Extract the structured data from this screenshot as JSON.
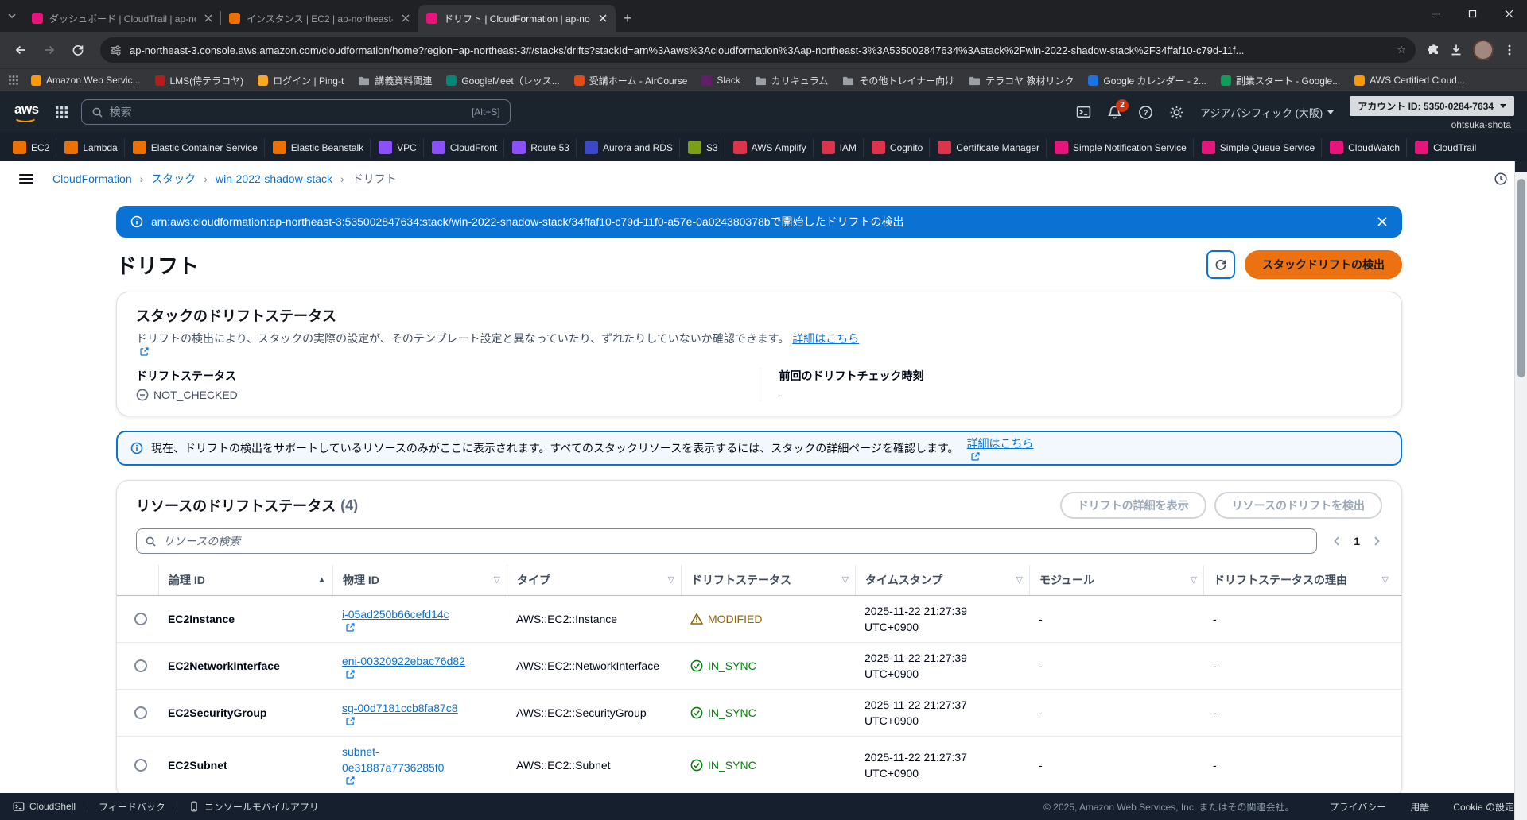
{
  "colors": {
    "accent_blue": "#0972d3",
    "primary_orange": "#ec7211",
    "status_warning": "#8d6605",
    "status_success": "#037f0c",
    "status_neutral": "#5f6b7a",
    "header_dark": "#1b232d",
    "banner_blue": "#0972d3"
  },
  "browser": {
    "tabs": [
      {
        "title": "ダッシュボード | CloudTrail | ap-no",
        "favicon_color": "#e7157b"
      },
      {
        "title": "インスタンス | EC2 | ap-northeast-",
        "favicon_color": "#ed7100"
      },
      {
        "title": "ドリフト | CloudFormation | ap-no",
        "favicon_color": "#e7157b"
      }
    ],
    "url": "ap-northeast-3.console.aws.amazon.com/cloudformation/home?region=ap-northeast-3#/stacks/drifts?stackId=arn%3Aaws%3Acloudformation%3Aap-northeast-3%3A535002847634%3Astack%2Fwin-2022-shadow-stack%2F34ffaf10-c79d-11f...",
    "bookmarks": [
      {
        "label": "Amazon Web Servic...",
        "icon": "aws-favicon",
        "color": "#ff9900"
      },
      {
        "label": "LMS(侍テラコヤ)",
        "icon": "lms-favicon",
        "color": "#b71c1c"
      },
      {
        "label": "ログイン | Ping-t",
        "icon": "pingt-favicon",
        "color": "#f9a825"
      },
      {
        "label": "講義資料関連",
        "icon": "folder-icon",
        "color": "#9aa0a6"
      },
      {
        "label": "GoogleMeet（レッス...",
        "icon": "meet-favicon",
        "color": "#00897b"
      },
      {
        "label": "受講ホーム - AirCourse",
        "icon": "aircourse-favicon",
        "color": "#e64a19"
      },
      {
        "label": "Slack",
        "icon": "slack-favicon",
        "color": "#611f69"
      },
      {
        "label": "カリキュラム",
        "icon": "folder-icon",
        "color": "#9aa0a6"
      },
      {
        "label": "その他トレイナー向け",
        "icon": "folder-icon",
        "color": "#9aa0a6"
      },
      {
        "label": "テラコヤ 教材リンク",
        "icon": "folder-icon",
        "color": "#9aa0a6"
      },
      {
        "label": "Google カレンダー - 2...",
        "icon": "calendar-favicon",
        "color": "#1a73e8"
      },
      {
        "label": "副業スタート - Google...",
        "icon": "sheets-favicon",
        "color": "#0f9d58"
      },
      {
        "label": "AWS Certified Cloud...",
        "icon": "aws-favicon",
        "color": "#ff9900"
      }
    ]
  },
  "aws_header": {
    "search_placeholder": "検索",
    "search_shortcut": "[Alt+S]",
    "notification_count": "2",
    "region": "アジアパシフィック (大阪)",
    "account_id": "アカウント ID: 5350-0284-7634",
    "account_name": "ohtsuka-shota"
  },
  "services": [
    {
      "label": "EC2",
      "color": "#ed7100"
    },
    {
      "label": "Lambda",
      "color": "#ed7100"
    },
    {
      "label": "Elastic Container Service",
      "color": "#ed7100"
    },
    {
      "label": "Elastic Beanstalk",
      "color": "#ed7100"
    },
    {
      "label": "VPC",
      "color": "#8c4fff"
    },
    {
      "label": "CloudFront",
      "color": "#8c4fff"
    },
    {
      "label": "Route 53",
      "color": "#8c4fff"
    },
    {
      "label": "Aurora and RDS",
      "color": "#3b48cc"
    },
    {
      "label": "S3",
      "color": "#7aa116"
    },
    {
      "label": "AWS Amplify",
      "color": "#dd344c"
    },
    {
      "label": "IAM",
      "color": "#dd344c"
    },
    {
      "label": "Cognito",
      "color": "#dd344c"
    },
    {
      "label": "Certificate Manager",
      "color": "#dd344c"
    },
    {
      "label": "Simple Notification Service",
      "color": "#e7157b"
    },
    {
      "label": "Simple Queue Service",
      "color": "#e7157b"
    },
    {
      "label": "CloudWatch",
      "color": "#e7157b"
    },
    {
      "label": "CloudTrail",
      "color": "#e7157b"
    }
  ],
  "breadcrumb": {
    "items": [
      {
        "label": "CloudFormation"
      },
      {
        "label": "スタック"
      },
      {
        "label": "win-2022-shadow-stack"
      },
      {
        "label": "ドリフト"
      }
    ]
  },
  "banner": {
    "text": "arn:aws:cloudformation:ap-northeast-3:535002847634:stack/win-2022-shadow-stack/34ffaf10-c79d-11f0-a57e-0a024380378bで開始したドリフトの検出"
  },
  "page": {
    "title": "ドリフト",
    "detect_button": "スタックドリフトの検出"
  },
  "stack_drift_card": {
    "title": "スタックのドリフトステータス",
    "description": "ドリフトの検出により、スタックの実際の設定が、そのテンプレート設定と異なっていたり、ずれたりしていないか確認できます。",
    "learn_more": "詳細はこちら",
    "status_label": "ドリフトステータス",
    "status_value": "NOT_CHECKED",
    "last_check_label": "前回のドリフトチェック時刻",
    "last_check_value": "-"
  },
  "info_alert": {
    "text": "現在、ドリフトの検出をサポートしているリソースのみがここに表示されます。すべてのスタックリソースを表示するには、スタックの詳細ページを確認します。",
    "learn_more": "詳細はこちら"
  },
  "resources_card": {
    "title": "リソースのドリフトステータス",
    "count": "(4)",
    "view_details_button": "ドリフトの詳細を表示",
    "detect_button": "リソースのドリフトを検出",
    "search_placeholder": "リソースの検索",
    "page_number": "1",
    "columns": [
      "論理 ID",
      "物理 ID",
      "タイプ",
      "ドリフトステータス",
      "タイムスタンプ",
      "モジュール",
      "ドリフトステータスの理由"
    ],
    "rows": [
      {
        "logical_id": "EC2Instance",
        "physical_id": "i-05ad250b66cefd14c",
        "type": "AWS::EC2::Instance",
        "status": "MODIFIED",
        "timestamp_date": "2025-11-22 21:27:39",
        "timestamp_tz": "UTC+0900",
        "module": "-",
        "reason": "-"
      },
      {
        "logical_id": "EC2NetworkInterface",
        "physical_id": "eni-00320922ebac76d82",
        "type": "AWS::EC2::NetworkInterface",
        "status": "IN_SYNC",
        "timestamp_date": "2025-11-22 21:27:39",
        "timestamp_tz": "UTC+0900",
        "module": "-",
        "reason": "-"
      },
      {
        "logical_id": "EC2SecurityGroup",
        "physical_id": "sg-00d7181ccb8fa87c8",
        "type": "AWS::EC2::SecurityGroup",
        "status": "IN_SYNC",
        "timestamp_date": "2025-11-22 21:27:37",
        "timestamp_tz": "UTC+0900",
        "module": "-",
        "reason": "-"
      },
      {
        "logical_id": "EC2Subnet",
        "physical_id": "subnet-0e31887a7736285f0",
        "type": "AWS::EC2::Subnet",
        "status": "IN_SYNC",
        "timestamp_date": "2025-11-22 21:27:37",
        "timestamp_tz": "UTC+0900",
        "module": "-",
        "reason": "-"
      }
    ]
  },
  "footer": {
    "cloudshell": "CloudShell",
    "feedback": "フィードバック",
    "mobile_app": "コンソールモバイルアプリ",
    "copyright": "© 2025, Amazon Web Services, Inc. またはその関連会社。",
    "privacy": "プライバシー",
    "terms": "用語",
    "cookies": "Cookie の設定"
  }
}
